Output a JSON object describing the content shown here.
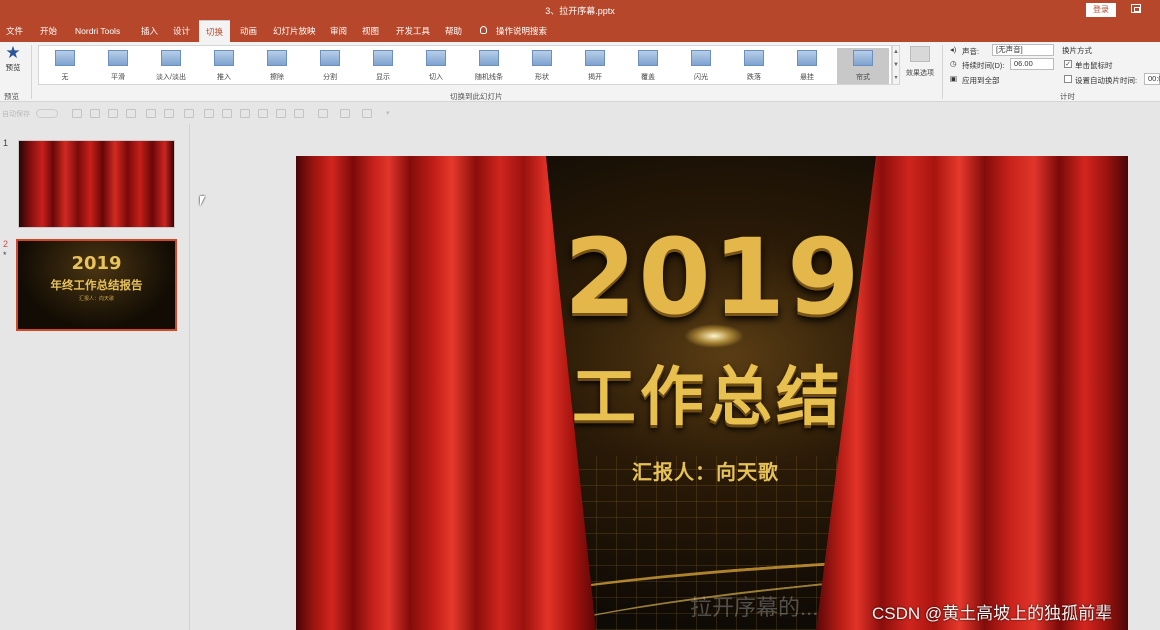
{
  "window": {
    "title": "3、拉开序幕.pptx",
    "login_label": "登录"
  },
  "tabs": [
    {
      "label": "文件"
    },
    {
      "label": "开始"
    },
    {
      "label": "Nordri Tools"
    },
    {
      "label": "插入"
    },
    {
      "label": "设计"
    },
    {
      "label": "切换",
      "active": true
    },
    {
      "label": "动画"
    },
    {
      "label": "幻灯片放映"
    },
    {
      "label": "审阅"
    },
    {
      "label": "视图"
    },
    {
      "label": "开发工具"
    },
    {
      "label": "帮助"
    }
  ],
  "tell_me": "操作说明搜索",
  "ribbon": {
    "preview_label": "预览",
    "preview_group": "预览",
    "transitions": [
      "无",
      "平滑",
      "淡入/淡出",
      "推入",
      "擦除",
      "分割",
      "显示",
      "切入",
      "随机线条",
      "形状",
      "揭开",
      "覆盖",
      "闪光",
      "跌落",
      "悬挂",
      "帘式"
    ],
    "active_transition": "帘式",
    "effect_options": "效果选项",
    "group_label": "切换到此幻灯片",
    "timing": {
      "sound_label": "声音:",
      "sound_value": "[无声音]",
      "duration_label": "持续时间(D):",
      "duration_value": "06.00",
      "apply_all": "应用到全部",
      "advance_label": "换片方式",
      "on_click": "单击鼠标时",
      "on_click_checked": true,
      "after_label": "设置自动换片时间:",
      "after_value": "00:0",
      "after_checked": false,
      "group_label": "计时"
    }
  },
  "qat": {
    "autosave": "自动保存"
  },
  "slides_pane": {
    "slides": [
      {
        "number": "1"
      },
      {
        "number": "2",
        "marker": "*",
        "year": "2019",
        "title": "年终工作总结报告",
        "subtitle": "汇报人：向天歌"
      }
    ]
  },
  "canvas": {
    "year": "2019",
    "heading": "工作总结",
    "reporter": "汇报人：向天歌"
  },
  "overlay": {
    "watermark": "CSDN @黄土高坡上的独孤前辈",
    "ghost_text": "拉开序幕的..."
  }
}
